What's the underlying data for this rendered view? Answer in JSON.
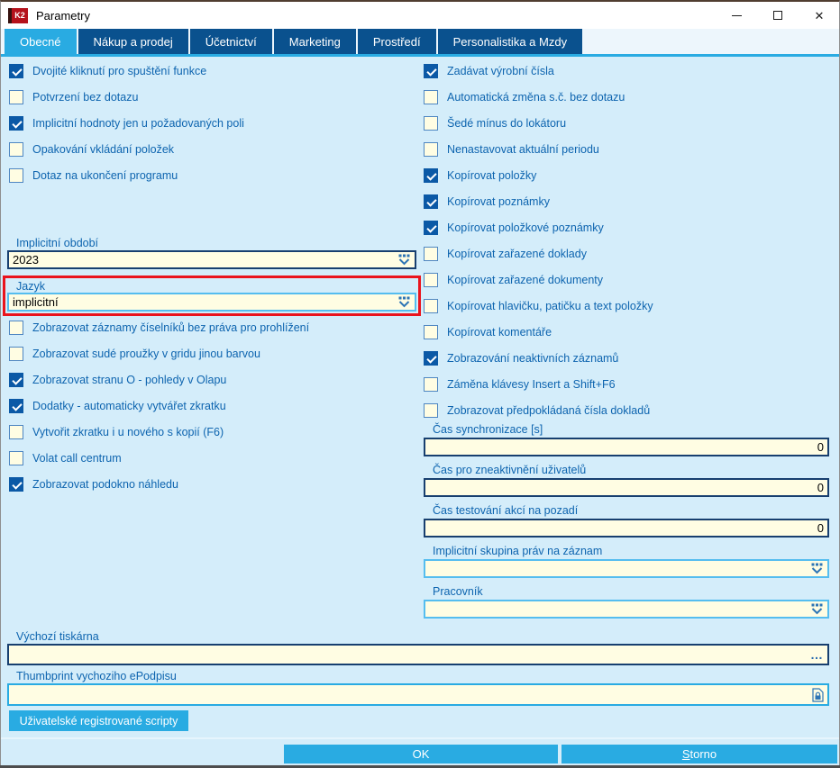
{
  "window": {
    "title": "Parametry",
    "logo_text": "K2"
  },
  "icons": {
    "close": "✕"
  },
  "tabs": [
    {
      "label": "Obecné",
      "active": true
    },
    {
      "label": "Nákup a prodej",
      "active": false
    },
    {
      "label": "Účetnictví",
      "active": false
    },
    {
      "label": "Marketing",
      "active": false
    },
    {
      "label": "Prostředí",
      "active": false
    },
    {
      "label": "Personalistika a Mzdy",
      "active": false
    }
  ],
  "checkbox_groups": {
    "left_top": [
      {
        "label": "Dvojité kliknutí pro spuštění funkce",
        "checked": true
      },
      {
        "label": "Potvrzení bez dotazu",
        "checked": false
      },
      {
        "label": "Implicitní hodnoty jen u požadovaných poli",
        "checked": true
      },
      {
        "label": "Opakování vkládání položek",
        "checked": false
      },
      {
        "label": "Dotaz na ukončení programu",
        "checked": false
      }
    ],
    "left_bottom": [
      {
        "label": "Zobrazovat záznamy číselníků bez práva pro prohlížení",
        "checked": false
      },
      {
        "label": "Zobrazovat sudé proužky v gridu jinou barvou",
        "checked": false
      },
      {
        "label": "Zobrazovat stranu O - pohledy v Olapu",
        "checked": true
      },
      {
        "label": "Dodatky - automaticky vytvářet zkratku",
        "checked": true
      },
      {
        "label": "Vytvořit zkratku i u nového s kopií (F6)",
        "checked": false
      },
      {
        "label": "Volat call centrum",
        "checked": false
      },
      {
        "label": "Zobrazovat podokno náhledu",
        "checked": true
      }
    ],
    "right": [
      {
        "label": "Zadávat výrobní čísla",
        "checked": true
      },
      {
        "label": "Automatická změna s.č. bez dotazu",
        "checked": false
      },
      {
        "label": "Šedé mínus do lokátoru",
        "checked": false
      },
      {
        "label": "Nenastavovat aktuální periodu",
        "checked": false
      },
      {
        "label": "Kopírovat položky",
        "checked": true
      },
      {
        "label": "Kopírovat poznámky",
        "checked": true
      },
      {
        "label": "Kopírovat položkové poznámky",
        "checked": true
      },
      {
        "label": "Kopírovat zařazené doklady",
        "checked": false
      },
      {
        "label": "Kopírovat zařazené dokumenty",
        "checked": false
      },
      {
        "label": "Kopírovat hlavičku, patičku a text položky",
        "checked": false
      },
      {
        "label": "Kopírovat komentáře",
        "checked": false
      },
      {
        "label": "Zobrazování neaktivních záznamů",
        "checked": true
      },
      {
        "label": "Záměna klávesy Insert a Shift+F6",
        "checked": false
      },
      {
        "label": "Zobrazovat předpokládaná čísla dokladů",
        "checked": false
      }
    ]
  },
  "period_field": {
    "label": "Implicitní období",
    "value": "2023"
  },
  "language_field": {
    "label": "Jazyk",
    "value": "implicitní"
  },
  "right_fields": [
    {
      "label": "Čas synchronizace [s]",
      "value": "0",
      "kind": "number"
    },
    {
      "label": "Čas pro zneaktivnění uživatelů",
      "value": "0",
      "kind": "number"
    },
    {
      "label": "Čas testování akcí na pozadí",
      "value": "0",
      "kind": "number"
    },
    {
      "label": "Implicitní skupina práv na záznam",
      "value": "",
      "kind": "dropdown"
    },
    {
      "label": "Pracovník",
      "value": "",
      "kind": "dropdown"
    }
  ],
  "printer_field": {
    "label": "Výchozí tiskárna",
    "value": "",
    "button": "…"
  },
  "thumbprint_field": {
    "label": "Thumbprint vychoziho ePodpisu",
    "value": ""
  },
  "buttons": {
    "scripts": "Uživatelské registrované scripty",
    "ok": "OK",
    "cancel": "Storno"
  },
  "colors": {
    "accent": "#29abe2",
    "tab_inactive": "#0a518e",
    "content_bg": "#d4edfa",
    "field_bg": "#fffde3",
    "navy_border": "#173f6f",
    "light_border": "#55bdef",
    "label_text": "#0d64af",
    "checked_blue": "#0b59a6",
    "highlight_red": "#ea141d"
  }
}
